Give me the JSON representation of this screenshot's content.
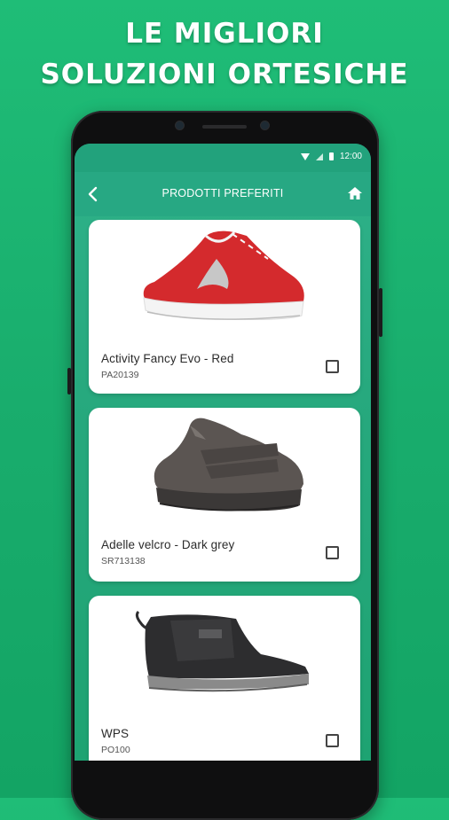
{
  "promo": {
    "line1": "LE MIGLIORI",
    "line2": "SOLUZIONI ORTESICHE"
  },
  "status_bar": {
    "time": "12:00",
    "icons": [
      "wifi-icon",
      "signal-icon",
      "battery-icon"
    ]
  },
  "app_bar": {
    "title": "PRODOTTI PREFERITI",
    "back_icon": "chevron-left-icon",
    "home_icon": "home-icon"
  },
  "products": [
    {
      "name": "Activity Fancy Evo - Red",
      "code": "PA20139",
      "color": "#d42a2d",
      "checked": false
    },
    {
      "name": "Adelle velcro - Dark grey",
      "code": "SR713138",
      "color": "#5b5552",
      "checked": false
    },
    {
      "name": "WPS",
      "code": "PO100",
      "color": "#2d2d2f",
      "checked": false
    }
  ],
  "colors": {
    "background": "#1bb26f",
    "app_bar": "#27a883",
    "card": "#ffffff"
  }
}
